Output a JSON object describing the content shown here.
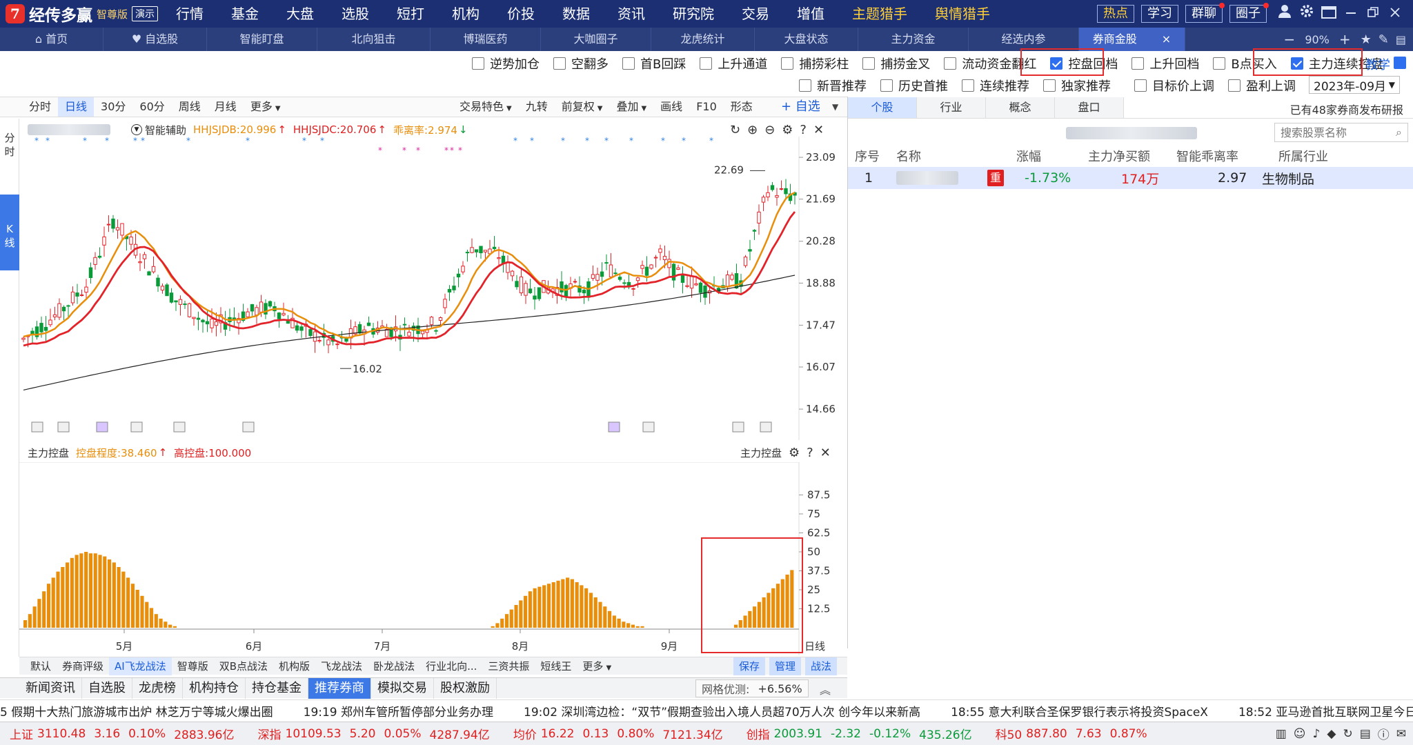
{
  "app": {
    "logo_glyph": "7",
    "name": "经传多赢",
    "edition": "智尊版",
    "demo": "演示"
  },
  "menu": [
    {
      "label": "行情"
    },
    {
      "label": "基金"
    },
    {
      "label": "大盘"
    },
    {
      "label": "选股"
    },
    {
      "label": "短打"
    },
    {
      "label": "机构"
    },
    {
      "label": "价投"
    },
    {
      "label": "数据"
    },
    {
      "label": "资讯"
    },
    {
      "label": "研究院"
    },
    {
      "label": "交易"
    },
    {
      "label": "增值"
    },
    {
      "label": "主题猎手"
    },
    {
      "label": "舆情猎手"
    }
  ],
  "top_buttons": [
    "热点",
    "学习",
    "群聊",
    "圈子"
  ],
  "tabs": [
    {
      "label": "首页",
      "icon": "⌂"
    },
    {
      "label": "自选股",
      "icon": "♥"
    },
    {
      "label": "智能盯盘"
    },
    {
      "label": "北向狙击"
    },
    {
      "label": "博瑞医药"
    },
    {
      "label": "大咖圈子"
    },
    {
      "label": "龙虎统计"
    },
    {
      "label": "大盘状态"
    },
    {
      "label": "主力资金"
    },
    {
      "label": "经选内参"
    },
    {
      "label": "券商金股"
    }
  ],
  "tab_close": "×",
  "zoom": {
    "minus": "−",
    "value": "90%",
    "plus": "+"
  },
  "filters_row1": [
    {
      "label": "逆势加仓",
      "checked": false
    },
    {
      "label": "空翻多",
      "checked": false
    },
    {
      "label": "首B回踩",
      "checked": false
    },
    {
      "label": "上升通道",
      "checked": false
    },
    {
      "label": "捕捞彩柱",
      "checked": false
    },
    {
      "label": "捕捞金叉",
      "checked": false
    },
    {
      "label": "流动资金翻红",
      "checked": false
    },
    {
      "label": "控盘回档",
      "checked": true
    },
    {
      "label": "上升回档",
      "checked": false
    },
    {
      "label": "B点买入",
      "checked": false
    },
    {
      "label": "主力连续控盘",
      "checked": true
    }
  ],
  "teach": "教学",
  "filters_row2": [
    {
      "label": "新晋推荐"
    },
    {
      "label": "历史首推"
    },
    {
      "label": "连续推荐"
    },
    {
      "label": "独家推荐"
    },
    {
      "label": "目标价上调"
    },
    {
      "label": "盈利上调"
    }
  ],
  "month_select": "2023年-09月",
  "chart_toolbar": {
    "left": [
      "分时",
      "日线",
      "30分",
      "60分",
      "周线",
      "月线",
      "更多"
    ],
    "right": [
      "交易特色",
      "九转",
      "前复权",
      "叠加",
      "画线",
      "F10",
      "形态"
    ],
    "add": "+ 自选"
  },
  "side_tabs": [
    "分时",
    "K线"
  ],
  "indicator_line": {
    "name": "智能辅助",
    "a": "HHJSJDB:20.996",
    "b": "HHJSJDC:20.706",
    "c": "乖离率:2.974"
  },
  "sub_indicator": {
    "name": "主力控盘",
    "a": "控盘程度:38.460",
    "b": "高控盘:100.000",
    "right": "主力控盘"
  },
  "chart_data": [
    {
      "type": "candlestick",
      "title": "",
      "y_ticks": [
        23.09,
        21.69,
        20.28,
        18.88,
        17.47,
        16.07,
        14.66
      ],
      "ylim": [
        14.2,
        23.6
      ],
      "annotations": [
        {
          "label": "22.69",
          "value": 22.69
        },
        {
          "label": "16.02",
          "value": 16.02
        }
      ],
      "series": [
        {
          "name": "HHJSJDB",
          "color": "#e3232a"
        },
        {
          "name": "HHJSJDC",
          "color": "#e88e0b"
        },
        {
          "name": "",
          "color": "#222222"
        }
      ]
    },
    {
      "type": "bar",
      "title": "",
      "y_ticks": [
        87.5,
        75.0,
        62.5,
        50.0,
        37.5,
        25.0,
        12.5
      ],
      "ylim": [
        0,
        100
      ],
      "x_ticks": [
        "5月",
        "6月",
        "7月",
        "8月",
        "9月"
      ],
      "values": [
        5,
        9,
        14,
        19,
        24,
        29,
        33,
        37,
        40,
        43,
        46,
        48,
        49,
        50,
        49,
        49,
        48,
        47,
        45,
        43,
        40,
        37,
        33,
        29,
        25,
        21,
        17,
        13,
        9,
        6,
        4,
        2,
        1,
        0,
        0,
        0,
        0,
        0,
        0,
        0,
        0,
        0,
        0,
        0,
        0,
        0,
        0,
        0,
        0,
        0,
        0,
        0,
        0,
        0,
        0,
        0,
        0,
        0,
        0,
        0,
        0,
        0,
        0,
        0,
        0,
        0,
        0,
        0,
        0,
        0,
        0,
        0,
        0,
        0,
        0,
        0,
        0,
        0,
        0,
        0,
        0,
        0,
        0,
        0,
        0,
        0,
        0,
        0,
        0,
        0,
        0,
        0,
        0,
        0,
        0,
        0,
        0,
        0,
        0,
        0,
        1,
        3,
        6,
        9,
        12,
        15,
        18,
        21,
        24,
        26,
        27,
        28,
        29,
        30,
        31,
        32,
        33,
        32,
        30,
        28,
        26,
        23,
        20,
        17,
        14,
        11,
        8,
        6,
        4,
        3,
        2,
        1,
        1,
        0,
        0,
        0,
        0,
        0,
        0,
        0,
        0,
        0,
        0,
        0,
        0,
        0,
        0,
        0,
        0,
        0,
        0,
        0,
        2,
        5,
        8,
        11,
        14,
        17,
        20,
        23,
        26,
        29,
        32,
        35,
        38
      ]
    }
  ],
  "right_panel": {
    "tabs": [
      "个股",
      "行业",
      "概念",
      "盘口"
    ],
    "note": "已有48家券商发布研报",
    "search_placeholder": "搜索股票名称",
    "headers": [
      "序号",
      "名称",
      "涨幅",
      "主力净买额",
      "智能乖离率",
      "所属行业"
    ],
    "rows": [
      {
        "idx": "1",
        "badge": "重",
        "change": "-1.73%",
        "net": "174万",
        "ratio": "2.97",
        "industry": "生物制品"
      }
    ]
  },
  "strategies": {
    "items": [
      "默认",
      "券商评级",
      "AI飞龙战法",
      "智尊版",
      "双B点战法",
      "机构版",
      "飞龙战法",
      "卧龙战法",
      "行业北向...",
      "三资共振",
      "短线王",
      "更多"
    ],
    "active": "AI飞龙战法",
    "right": [
      "保存",
      "管理",
      "战法"
    ],
    "day_label": "日线"
  },
  "news_tabs": [
    "新闻资讯",
    "自选股",
    "龙虎榜",
    "机构持仓",
    "持仓基金",
    "推荐券商",
    "模拟交易",
    "股权激励"
  ],
  "news_active": "推荐券商",
  "grid_opt": {
    "label": "网格优测:",
    "value": "+6.56%"
  },
  "ticker": [
    "5 假期十大热门旅游城市出炉 林芝万宁等城火爆出圈",
    "19:19 郑州车管所暂停部分业务办理",
    "19:02 深圳湾边检：“双节”假期查验出入境人员超70万人次 创今年以来新高",
    "18:55 意大利联合圣保罗银行表示将投资SpaceX",
    "18:52 亚马逊首批互联网卫星今日"
  ],
  "indices": [
    {
      "name": "上证",
      "price": "3110.48",
      "chg": "3.16",
      "pct": "0.10%",
      "amt": "2883.96亿"
    },
    {
      "name": "深指",
      "price": "10109.53",
      "chg": "5.20",
      "pct": "0.05%",
      "amt": "4287.94亿"
    },
    {
      "name": "均价",
      "price": "16.22",
      "chg": "0.13",
      "pct": "0.80%",
      "amt": "7121.34亿"
    },
    {
      "name": "创指",
      "price": "2003.91",
      "chg": "-2.32",
      "pct": "-0.12%",
      "amt": "435.26亿"
    },
    {
      "name": "科50",
      "price": "887.80",
      "chg": "7.63",
      "pct": "0.87%"
    }
  ]
}
